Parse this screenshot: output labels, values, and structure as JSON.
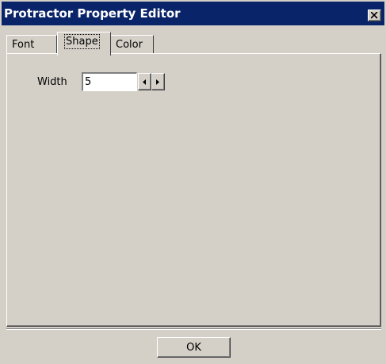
{
  "window": {
    "title": "Protractor Property Editor",
    "close_icon": "close-icon"
  },
  "tabs": [
    {
      "label": "Font",
      "active": false
    },
    {
      "label": "Shape",
      "active": true
    },
    {
      "label": "Color",
      "active": false
    }
  ],
  "shape_panel": {
    "width_label": "Width",
    "width_value": "5",
    "decrement_icon": "left-arrow-icon",
    "increment_icon": "right-arrow-icon"
  },
  "footer": {
    "ok_label": "OK"
  },
  "colors": {
    "titlebar": "#0a246a",
    "face": "#d4d0c8"
  }
}
